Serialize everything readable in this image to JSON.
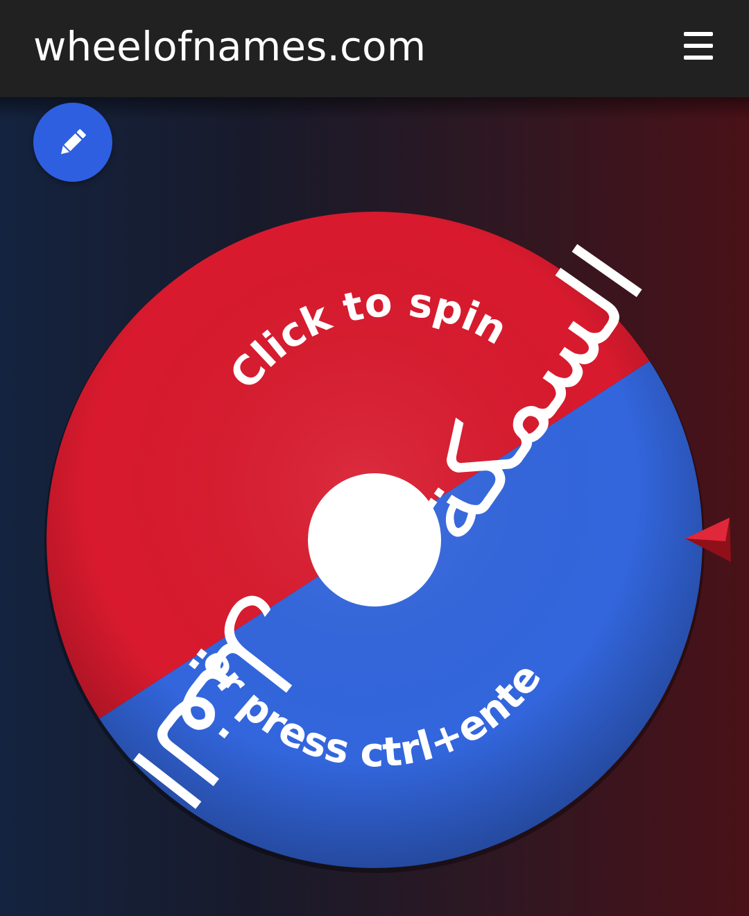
{
  "header": {
    "title": "wheelofnames.com",
    "menu_icon": "hamburger-menu-icon"
  },
  "toolbar": {
    "edit_icon": "pencil-icon"
  },
  "wheel": {
    "spin_prompt_line1": "Click to spin",
    "spin_prompt_line2": "or press ctrl+enter",
    "entries": [
      {
        "label": "السمكة",
        "color": "#d91a2e"
      },
      {
        "label": "الفيل",
        "color": "#3366dd"
      }
    ],
    "hub_color": "#ffffff",
    "pointer_color": "#d91a2e",
    "pointer_icon": "pointer-arrow-icon"
  },
  "colors": {
    "app_bar": "#212121",
    "edit_button": "#2e5fe0",
    "background_left": "#14233f",
    "background_right": "#4a1118"
  }
}
